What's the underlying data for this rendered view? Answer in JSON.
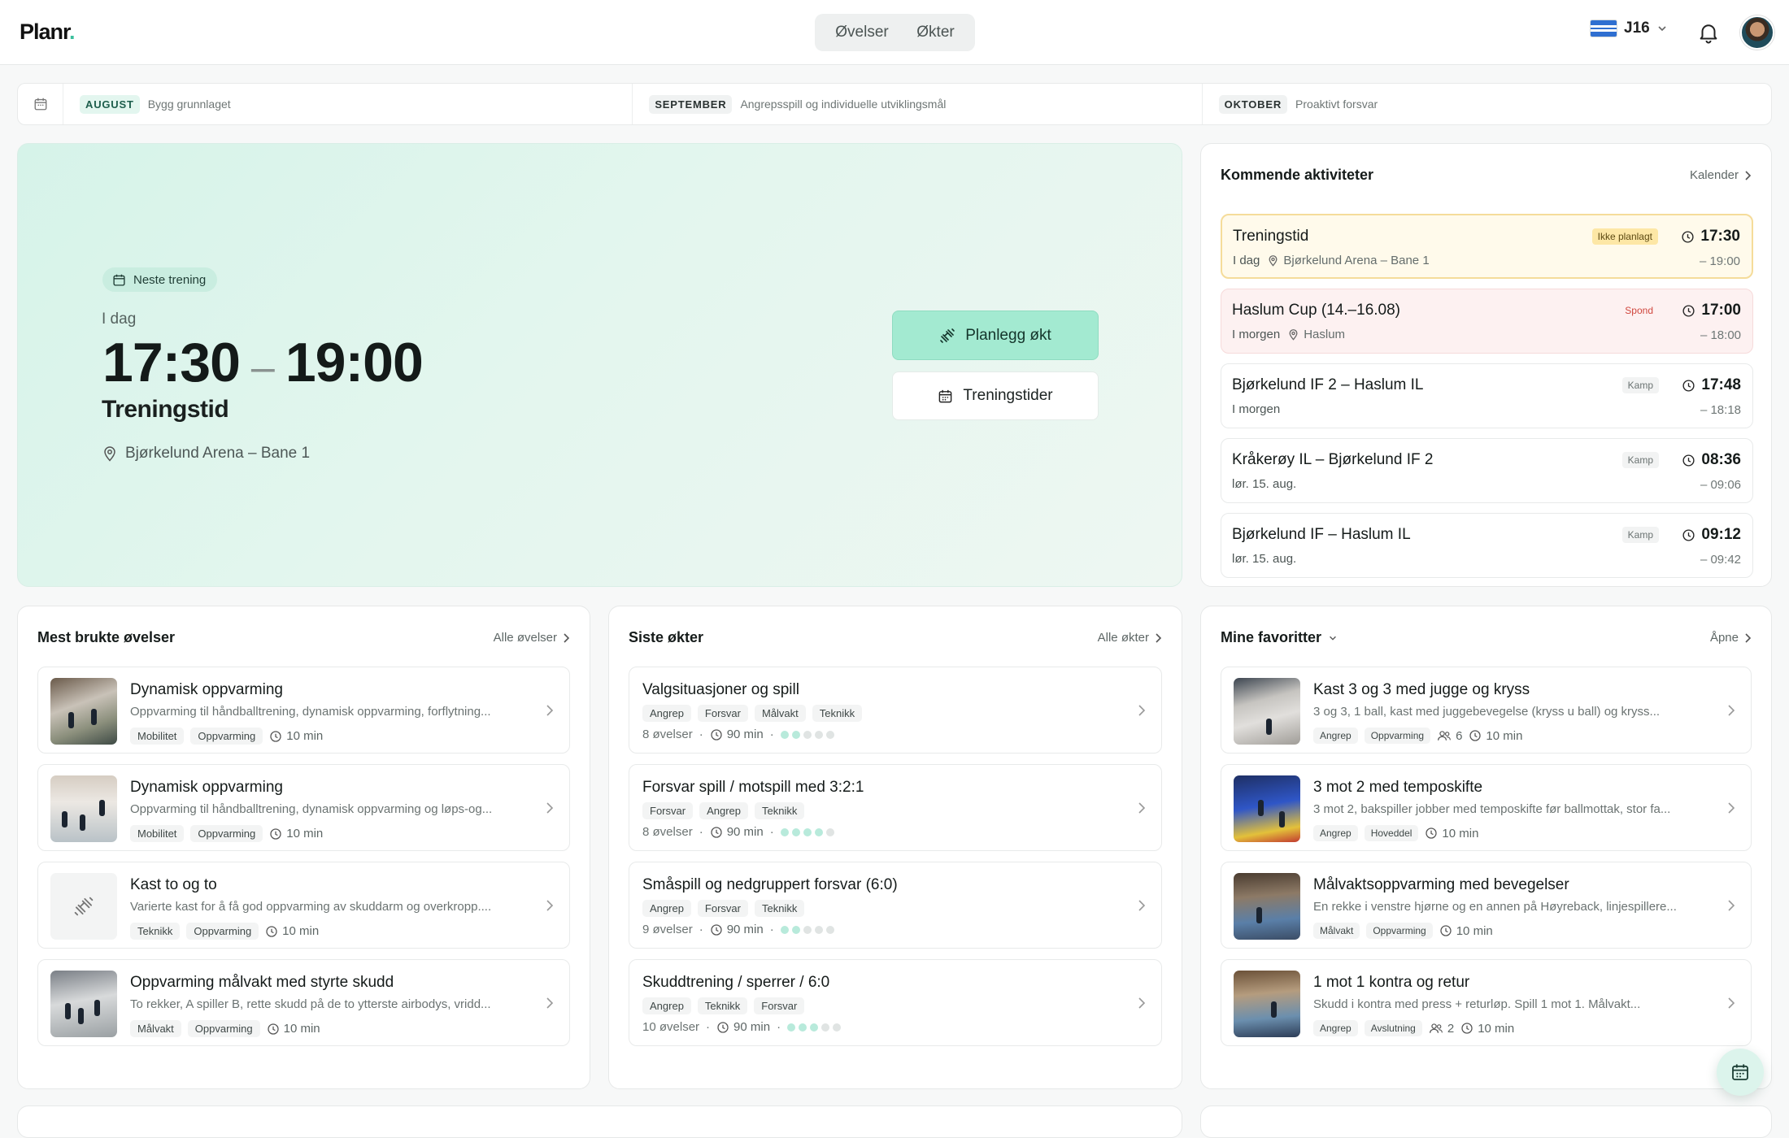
{
  "app": {
    "logo": "Planr",
    "logo_dot": "."
  },
  "top_nav": {
    "tabs": [
      "Øvelser",
      "Økter"
    ]
  },
  "team": {
    "label": "J16"
  },
  "periods": [
    {
      "month": "AUGUST",
      "desc": "Bygg grunnlaget"
    },
    {
      "month": "SEPTEMBER",
      "desc": "Angrepsspill og individuelle utviklingsmål"
    },
    {
      "month": "OKTOBER",
      "desc": "Proaktivt forsvar"
    }
  ],
  "next_training": {
    "pill": "Neste trening",
    "day": "I dag",
    "start": "17:30",
    "dash": "–",
    "end": "19:00",
    "title": "Treningstid",
    "location": "Bjørkelund Arena – Bane 1",
    "plan_button": "Planlegg økt",
    "times_button": "Treningstider"
  },
  "upcoming": {
    "title": "Kommende aktiviteter",
    "link": "Kalender",
    "items": [
      {
        "name": "Treningstid",
        "day": "I dag",
        "place": "Bjørkelund Arena – Bane 1",
        "tag": "Ikke planlagt",
        "start": "17:30",
        "end": "– 19:00"
      },
      {
        "name": "Haslum Cup (14.–16.08)",
        "day": "I morgen",
        "place": "Haslum",
        "tag": "Spond",
        "start": "17:00",
        "end": "– 18:00"
      },
      {
        "name": "Bjørkelund IF 2 – Haslum IL",
        "day": "I morgen",
        "place": "",
        "tag": "Kamp",
        "start": "17:48",
        "end": "– 18:18"
      },
      {
        "name": "Kråkerøy IL – Bjørkelund IF 2",
        "day": "lør. 15. aug.",
        "place": "",
        "tag": "Kamp",
        "start": "08:36",
        "end": "– 09:06"
      },
      {
        "name": "Bjørkelund IF – Haslum IL",
        "day": "lør. 15. aug.",
        "place": "",
        "tag": "Kamp",
        "start": "09:12",
        "end": "– 09:42"
      }
    ]
  },
  "exercises": {
    "title": "Mest brukte øvelser",
    "link": "Alle øvelser",
    "items": [
      {
        "title": "Dynamisk oppvarming",
        "desc": "Oppvarming til håndballtrening, dynamisk oppvarming, forflytning...",
        "tags": [
          "Mobilitet",
          "Oppvarming"
        ],
        "duration": "10 min"
      },
      {
        "title": "Dynamisk oppvarming",
        "desc": "Oppvarming til håndballtrening, dynamisk oppvarming og løps-og...",
        "tags": [
          "Mobilitet",
          "Oppvarming"
        ],
        "duration": "10 min"
      },
      {
        "title": "Kast to og to",
        "desc": "Varierte kast for å få god oppvarming av skuddarm og overkropp....",
        "tags": [
          "Teknikk",
          "Oppvarming"
        ],
        "duration": "10 min"
      },
      {
        "title": "Oppvarming målvakt med styrte skudd",
        "desc": "To rekker, A spiller B, rette skudd på de to ytterste airbodys, vridd...",
        "tags": [
          "Målvakt",
          "Oppvarming"
        ],
        "duration": "10 min"
      }
    ]
  },
  "sessions": {
    "title": "Siste økter",
    "link": "Alle økter",
    "items": [
      {
        "title": "Valgsituasjoner og spill",
        "tags": [
          "Angrep",
          "Forsvar",
          "Målvakt",
          "Teknikk"
        ],
        "count": "8 øvelser",
        "duration": "90 min",
        "level": 2
      },
      {
        "title": "Forsvar spill / motspill med 3:2:1",
        "tags": [
          "Forsvar",
          "Angrep",
          "Teknikk"
        ],
        "count": "8 øvelser",
        "duration": "90 min",
        "level": 4
      },
      {
        "title": "Småspill og nedgruppert forsvar (6:0)",
        "tags": [
          "Angrep",
          "Forsvar",
          "Teknikk"
        ],
        "count": "9 øvelser",
        "duration": "90 min",
        "level": 2
      },
      {
        "title": "Skuddtrening / sperrer / 6:0",
        "tags": [
          "Angrep",
          "Teknikk",
          "Forsvar"
        ],
        "count": "10 øvelser",
        "duration": "90 min",
        "level": 3
      }
    ]
  },
  "favorites": {
    "title": "Mine favoritter",
    "link": "Åpne",
    "items": [
      {
        "title": "Kast 3 og 3 med jugge og kryss",
        "desc": "3 og 3, 1 ball, kast med juggebevegelse (kryss u ball) og kryss...",
        "tags": [
          "Angrep",
          "Oppvarming"
        ],
        "players": "6",
        "duration": "10 min"
      },
      {
        "title": "3 mot 2 med temposkifte",
        "desc": "3 mot 2, bakspiller jobber med temposkifte før ballmottak, stor fa...",
        "tags": [
          "Angrep",
          "Hoveddel"
        ],
        "players": "",
        "duration": "10 min"
      },
      {
        "title": "Målvaktsoppvarming med bevegelser",
        "desc": "En rekke i venstre hjørne og en annen på Høyreback, linjespillere...",
        "tags": [
          "Målvakt",
          "Oppvarming"
        ],
        "players": "",
        "duration": "10 min"
      },
      {
        "title": "1 mot 1 kontra og retur",
        "desc": "Skudd i kontra med press + returløp. Spill 1 mot 1. Målvakt...",
        "tags": [
          "Angrep",
          "Avslutning"
        ],
        "players": "2",
        "duration": "10 min"
      }
    ]
  },
  "colors": {
    "accent": "#a3ead1",
    "hero_bg": "#d6f3e9",
    "warn": "#fde7a6",
    "danger": "#d0473e"
  }
}
